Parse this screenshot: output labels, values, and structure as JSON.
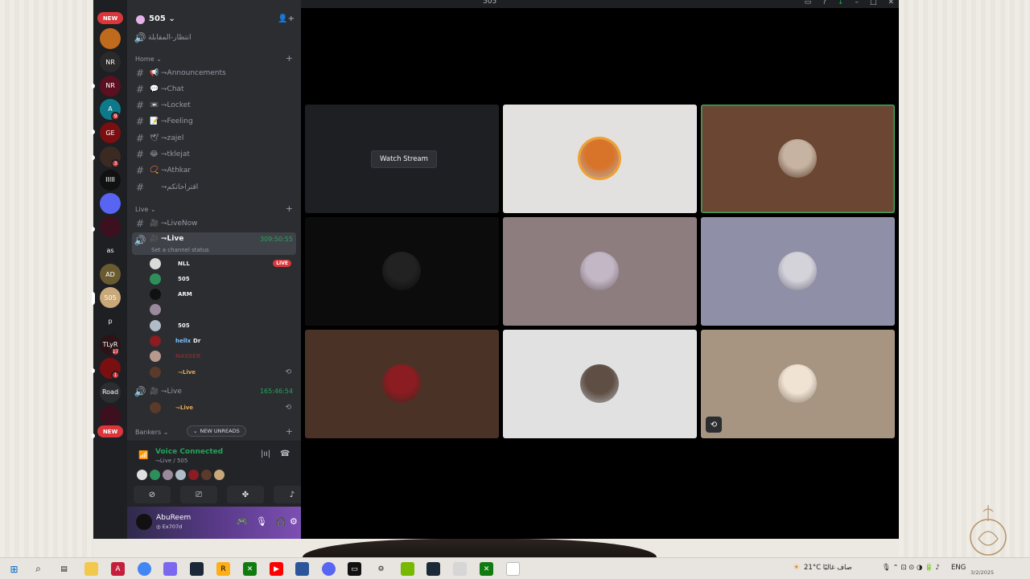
{
  "window": {
    "title": "505"
  },
  "rail": {
    "new_label_top": "NEW",
    "new_label_bottom": "NEW",
    "servers": [
      {
        "label": "",
        "color": "#c06a1d",
        "badge": ""
      },
      {
        "label": "NR",
        "color": "#2a2a2a",
        "badge": ""
      },
      {
        "label": "NR",
        "color": "#5a1020",
        "badge": ""
      },
      {
        "label": "A",
        "color": "#0c7a8a",
        "badge": "9"
      },
      {
        "label": "GE",
        "color": "#7a0f12",
        "badge": ""
      },
      {
        "label": "",
        "color": "#3a2a22",
        "badge": "3"
      },
      {
        "label": "IIIII",
        "color": "#111111",
        "badge": ""
      },
      {
        "label": "",
        "color": "#5865f2",
        "badge": ""
      },
      {
        "label": "",
        "color": "#3d1020",
        "badge": ""
      },
      {
        "label": "as",
        "color": "#1e1f22",
        "badge": ""
      },
      {
        "label": "AD",
        "color": "#6a5a30",
        "badge": ""
      },
      {
        "label": "505",
        "color": "#c9a87a",
        "badge": ""
      },
      {
        "label": "p",
        "color": "#1e1f22",
        "badge": ""
      },
      {
        "label": "TLyR",
        "color": "#2a1418",
        "badge": "17"
      },
      {
        "label": "",
        "color": "#7a0f12",
        "badge": "1"
      },
      {
        "label": "Road",
        "color": "#2b2d31",
        "badge": ""
      },
      {
        "label": "",
        "color": "#3d1020",
        "badge": ""
      }
    ]
  },
  "server_header": {
    "name": "505 ⌄"
  },
  "top_channel": {
    "label": "انتظار-المقابلة"
  },
  "categories": {
    "home": "Home ⌄",
    "live": "Live ⌄",
    "bankers": "Bankers ⌄"
  },
  "home_channels": [
    {
      "emoji": "📢",
      "label": "⇁Announcements"
    },
    {
      "emoji": "💬",
      "label": "⇁Chat"
    },
    {
      "emoji": "📼",
      "label": "⇁Locket"
    },
    {
      "emoji": "📝",
      "label": "⇁Feeling"
    },
    {
      "emoji": "🕊",
      "label": "⇁zajel"
    },
    {
      "emoji": "😂",
      "label": "⇁tklejat"
    },
    {
      "emoji": "📿",
      "label": "⇁Athkar"
    },
    {
      "emoji": "",
      "label": "⇁اقتراحاتكم"
    }
  ],
  "live_channels": {
    "livenow": "⇁LiveNow",
    "live1": "⇁Live",
    "live1_timer": "309:50:55",
    "live1_status": "Set a channel status",
    "live2": "⇁Live",
    "live2_timer": "165:46:54",
    "live_badge": "LIVE"
  },
  "voice_users": [
    {
      "name": "",
      "tag": "NLL",
      "color": "#f2f3f5",
      "avatar": "#dadada",
      "live": true
    },
    {
      "name": "",
      "tag": "505",
      "color": "#f2f3f5",
      "avatar": "#2f8f5a",
      "live": false
    },
    {
      "name": "",
      "tag": "ARM",
      "color": "#f2f3f5",
      "avatar": "#111111",
      "live": false
    },
    {
      "name": "",
      "tag": "",
      "color": "#f2f3f5",
      "avatar": "#9a8a9c",
      "live": false
    },
    {
      "name": "",
      "tag": "505",
      "color": "#f2f3f5",
      "avatar": "#b0bcc8",
      "live": false
    },
    {
      "name": "hellx",
      "tag": "Dr",
      "color": "#7dc0ff",
      "avatar": "#8a1c22",
      "live": false
    },
    {
      "name": "NASSER",
      "tag": "",
      "color": "#7a2d2d",
      "avatar": "#b7998d",
      "live": false
    },
    {
      "name": "",
      "tag": "⇁Live",
      "color": "#e3a857",
      "avatar": "#5a3a2a",
      "live": false
    }
  ],
  "live2_user": {
    "tag": "⇁Live"
  },
  "new_unreads": "NEW UNREADS",
  "voice_panel": {
    "status": "Voice Connected",
    "sub": "⇁Live / 505"
  },
  "user_panel": {
    "name": "AbuReem",
    "sub": "◎ Ex707d"
  },
  "stage": {
    "watch_stream": "Watch Stream",
    "tiles": [
      {
        "bg": "#1e1f22",
        "avatar": "",
        "watch": true
      },
      {
        "bg": "#e3e1df",
        "avatar": "#d8732a"
      },
      {
        "bg": "#6b4632",
        "avatar": "#c7b3a1",
        "highlight": true
      },
      {
        "bg": "#0c0c0c",
        "avatar": "#222222"
      },
      {
        "bg": "#8e7d7f",
        "avatar": "#c3b7c6"
      },
      {
        "bg": "#8f8fa7",
        "avatar": "#d5d3da"
      },
      {
        "bg": "#4a3326",
        "avatar": "#8a1c22"
      },
      {
        "bg": "#e1e1e1",
        "avatar": "#5e4e44"
      },
      {
        "bg": "#a79582",
        "avatar": "#f0e3d4",
        "icon": true
      }
    ]
  },
  "taskbar": {
    "weather": "21°C صاف غالبًا",
    "lang": "ENG",
    "date": "3/2/2025"
  },
  "colors": {
    "accent_green": "#23a55a",
    "danger": "#da373c",
    "blurple": "#5865f2"
  }
}
